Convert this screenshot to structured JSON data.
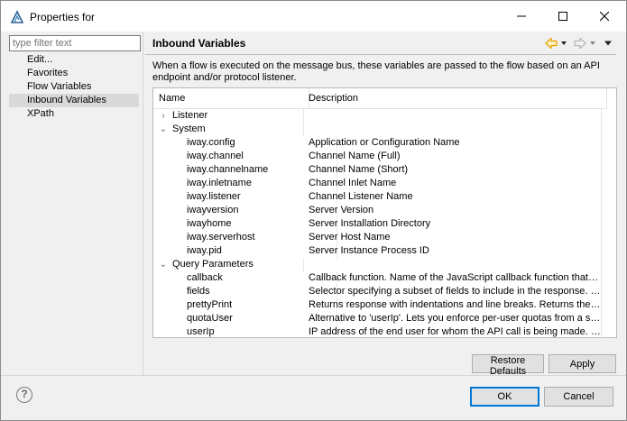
{
  "window": {
    "title": "Properties for",
    "icon": "app-logo-icon",
    "controls": [
      "minimize-icon",
      "maximize-icon",
      "close-icon"
    ]
  },
  "sidebar": {
    "filter_placeholder": "type filter text",
    "items": [
      {
        "label": "Edit...",
        "selected": false
      },
      {
        "label": "Favorites",
        "selected": false
      },
      {
        "label": "Flow Variables",
        "selected": false
      },
      {
        "label": "Inbound Variables",
        "selected": true
      },
      {
        "label": "XPath",
        "selected": false
      }
    ]
  },
  "page": {
    "title": "Inbound Variables",
    "description": "When a flow is executed on the message bus, these variables are passed to the flow based on an API endpoint and/or protocol listener.",
    "nav_icons": [
      "back-arrow-icon",
      "back-dropdown-icon",
      "forward-arrow-icon",
      "forward-dropdown-icon",
      "view-menu-icon"
    ]
  },
  "table": {
    "columns": [
      "Name",
      "Description"
    ],
    "groups": [
      {
        "name": "Listener",
        "expanded": false,
        "children": []
      },
      {
        "name": "System",
        "expanded": true,
        "children": [
          {
            "name": "iway.config",
            "description": "Application or Configuration Name"
          },
          {
            "name": "iway.channel",
            "description": "Channel Name (Full)"
          },
          {
            "name": "iway.channelname",
            "description": "Channel Name (Short)"
          },
          {
            "name": "iway.inletname",
            "description": "Channel Inlet Name"
          },
          {
            "name": "iway.listener",
            "description": "Channel Listener Name"
          },
          {
            "name": "iwayversion",
            "description": "Server Version"
          },
          {
            "name": "iwayhome",
            "description": "Server Installation Directory"
          },
          {
            "name": "iway.serverhost",
            "description": "Server Host Name"
          },
          {
            "name": "iway.pid",
            "description": "Server Instance Process ID"
          }
        ]
      },
      {
        "name": "Query Parameters",
        "expanded": true,
        "children": [
          {
            "name": "callback",
            "description": "Callback function. Name of the JavaScript callback function that handles..."
          },
          {
            "name": "fields",
            "description": "Selector specifying a subset of fields to include in the response. For more..."
          },
          {
            "name": "prettyPrint",
            "description": "Returns response with indentations and line breaks. Returns the response..."
          },
          {
            "name": "quotaUser",
            "description": "Alternative to 'userIp'. Lets you enforce per-user quotas from a server-sid..."
          },
          {
            "name": "userIp",
            "description": "IP address of the end user for whom the API call is being made. Lets you ..."
          }
        ]
      }
    ]
  },
  "buttons": {
    "restore_defaults": "Restore Defaults",
    "apply": "Apply",
    "ok": "OK",
    "cancel": "Cancel",
    "help": "?"
  },
  "colors": {
    "nav_arrow": "#e8a200",
    "selection": "#d9d9d9",
    "default_button_border": "#0078d7"
  }
}
